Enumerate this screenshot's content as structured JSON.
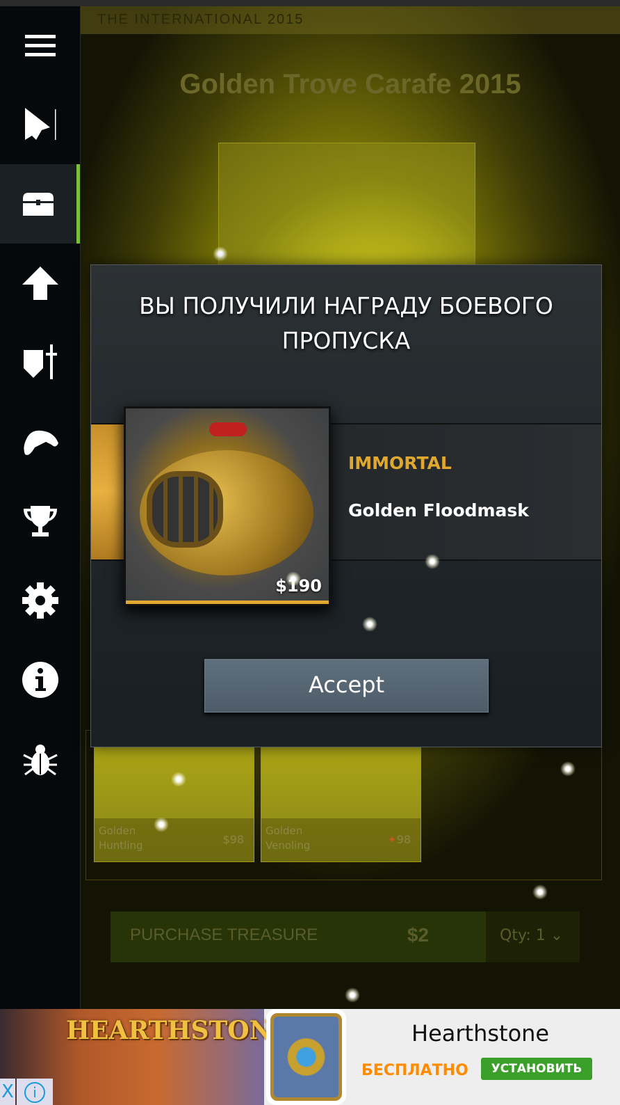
{
  "sidebar": {
    "items": [
      {
        "icon": "menu-icon"
      },
      {
        "icon": "cursor-icon"
      },
      {
        "icon": "treasure-chest-icon",
        "active": true
      },
      {
        "icon": "arrow-up-icon"
      },
      {
        "icon": "shield-sword-icon"
      },
      {
        "icon": "gamepad-icon"
      },
      {
        "icon": "trophy-icon"
      },
      {
        "icon": "gear-icon"
      },
      {
        "icon": "info-icon"
      },
      {
        "icon": "bug-icon"
      }
    ],
    "accent": "#7bbf3a"
  },
  "header": {
    "event": "THE INTERNATIONAL 2015"
  },
  "treasure": {
    "title": "Golden Trove Carafe 2015",
    "items": [
      {
        "name_line1": "Golden",
        "name_line2": "Huntling",
        "price": "$98"
      },
      {
        "name_line1": "Golden",
        "name_line2": "Venoling",
        "price": "98"
      }
    ],
    "purchase_label": "PURCHASE TREASURE",
    "purchase_price": "$2",
    "qty_label": "Qty: 1"
  },
  "modal": {
    "title_line1": "ВЫ ПОЛУЧИЛИ НАГРАДУ БОЕВОГО",
    "title_line2": "ПРОПУСКА",
    "rarity": "IMMORTAL",
    "rarity_color": "#e0a82e",
    "item_name": "Golden Floodmask",
    "item_price": "$190",
    "accept_label": "Accept"
  },
  "ad": {
    "logo": "HEARTHSTONE",
    "app_name": "Hearthstone",
    "price_label": "БЕСПЛАТНО",
    "install_label": "УСТАНОВИТЬ",
    "close_label": "X",
    "info_label": "i"
  }
}
